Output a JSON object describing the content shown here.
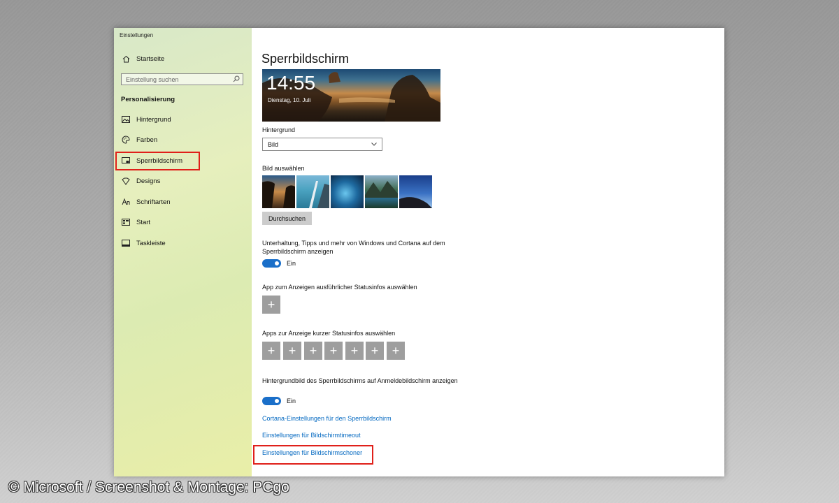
{
  "window": {
    "title": "Einstellungen"
  },
  "sidebar": {
    "home": "Startseite",
    "search_placeholder": "Einstellung suchen",
    "section": "Personalisierung",
    "items": [
      {
        "label": "Hintergrund",
        "icon": "picture-icon"
      },
      {
        "label": "Farben",
        "icon": "palette-icon"
      },
      {
        "label": "Sperrbildschirm",
        "icon": "lock-screen-icon",
        "selected": true
      },
      {
        "label": "Designs",
        "icon": "designs-icon"
      },
      {
        "label": "Schriftarten",
        "icon": "font-icon"
      },
      {
        "label": "Start",
        "icon": "start-icon"
      },
      {
        "label": "Taskleiste",
        "icon": "taskbar-icon"
      }
    ]
  },
  "main": {
    "title": "Sperrbildschirm",
    "preview": {
      "time": "14:55",
      "date": "Dienstag, 10. Juli"
    },
    "background_label": "Hintergrund",
    "background_value": "Bild",
    "choose_picture_label": "Bild auswählen",
    "browse_button": "Durchsuchen",
    "fun_facts_label": "Unterhaltung, Tipps und mehr von Windows und Cortana auf dem Sperrbildschirm anzeigen",
    "fun_facts_state": "Ein",
    "detailed_status_label": "App zum Anzeigen ausführlicher Statusinfos auswählen",
    "quick_status_label": "Apps zur Anzeige kurzer Statusinfos auswählen",
    "signin_background_label": "Hintergrundbild des Sperrbildschirms auf Anmeldebildschirm anzeigen",
    "signin_background_state": "Ein",
    "links": {
      "cortana": "Cortana-Einstellungen für den Sperrbildschirm",
      "timeout": "Einstellungen für Bildschirmtimeout",
      "screensaver": "Einstellungen für Bildschirmschoner"
    }
  },
  "credit": "© Microsoft / Screenshot & Montage: PCgo",
  "colors": {
    "accent": "#0067c0",
    "toggle": "#1a6fc9",
    "highlight": "#e0201a"
  }
}
